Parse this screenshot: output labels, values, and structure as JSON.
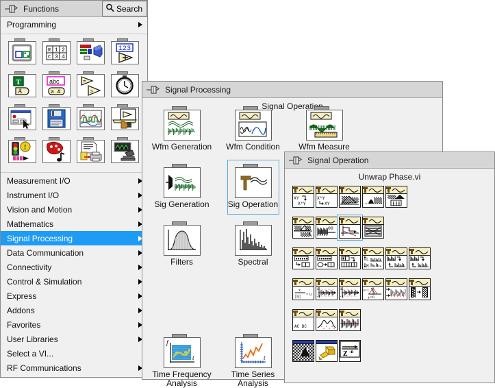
{
  "functions_palette": {
    "title": "Functions",
    "pin_icon": "pin-icon",
    "search": {
      "label": "Search",
      "icon": "search-icon"
    },
    "top_item": {
      "label": "Programming",
      "arrow": "chevron-right-icon"
    },
    "icon_rows": [
      [
        {
          "name": "structures-folder",
          "icon": "structures-icon"
        },
        {
          "name": "array-folder",
          "icon": "array-grid-icon"
        },
        {
          "name": "cluster-class-variant-folder",
          "icon": "cluster-icon"
        },
        {
          "name": "numeric-folder",
          "icon": "numeric-123-icon"
        }
      ],
      [
        {
          "name": "boolean-folder",
          "icon": "boolean-t-icon"
        },
        {
          "name": "string-folder",
          "icon": "string-abc-icon"
        },
        {
          "name": "comparison-folder",
          "icon": "comparison-icon"
        },
        {
          "name": "timing-folder",
          "icon": "clock-icon"
        }
      ],
      [
        {
          "name": "dialog-user-interface-folder",
          "icon": "dialog-cursor-icon"
        },
        {
          "name": "file-io-folder",
          "icon": "floppy-disk-icon"
        },
        {
          "name": "waveform-folder",
          "icon": "waveform-graph-icon"
        },
        {
          "name": "application-control-folder",
          "icon": "hand-vi-icon"
        }
      ],
      [
        {
          "name": "synchronization-folder",
          "icon": "traffic-light-icon"
        },
        {
          "name": "graphics-sound-folder",
          "icon": "palette-note-icon"
        },
        {
          "name": "report-generation-folder",
          "icon": "printer-doc-icon"
        },
        {
          "name": "measurement-folder",
          "icon": "microscope-icon"
        }
      ]
    ],
    "menu_items": [
      {
        "label": "Measurement I/O",
        "selected": false,
        "has_arrow": true
      },
      {
        "label": "Instrument I/O",
        "selected": false,
        "has_arrow": true
      },
      {
        "label": "Vision and Motion",
        "selected": false,
        "has_arrow": true
      },
      {
        "label": "Mathematics",
        "selected": false,
        "has_arrow": true
      },
      {
        "label": "Signal Processing",
        "selected": true,
        "has_arrow": true
      },
      {
        "label": "Data Communication",
        "selected": false,
        "has_arrow": true
      },
      {
        "label": "Connectivity",
        "selected": false,
        "has_arrow": true
      },
      {
        "label": "Control & Simulation",
        "selected": false,
        "has_arrow": true
      },
      {
        "label": "Express",
        "selected": false,
        "has_arrow": true
      },
      {
        "label": "Addons",
        "selected": false,
        "has_arrow": true
      },
      {
        "label": "Favorites",
        "selected": false,
        "has_arrow": true
      },
      {
        "label": "User Libraries",
        "selected": false,
        "has_arrow": true
      },
      {
        "label": "Select a VI...",
        "selected": false,
        "has_arrow": false
      },
      {
        "label": "RF Communications",
        "selected": false,
        "has_arrow": true
      }
    ]
  },
  "signal_processing_palette": {
    "title": "Signal Processing",
    "pin_icon": "pin-icon",
    "hover_caption": "Signal Operation",
    "items": [
      {
        "label": "Wfm Generation",
        "icon": "wfm-generation-icon",
        "selected": false
      },
      {
        "label": "Wfm Condition",
        "icon": "wfm-condition-icon",
        "selected": false
      },
      {
        "label": "Wfm Measure",
        "icon": "wfm-measure-icon",
        "selected": false
      },
      {
        "label": "Sig Generation",
        "icon": "sig-generation-icon",
        "selected": false
      },
      {
        "label": "Sig Operation",
        "icon": "sig-operation-icon",
        "selected": true
      },
      {
        "label": "Filters",
        "icon": "filters-icon",
        "selected": false
      },
      {
        "label": "Spectral",
        "icon": "spectral-icon",
        "selected": false
      },
      {
        "label": "Time Frequency\nAnalysis",
        "icon": "time-frequency-analysis-icon",
        "selected": false
      },
      {
        "label": "Time Series\nAnalysis",
        "icon": "time-series-analysis-icon",
        "selected": false
      }
    ],
    "item_labels": {
      "wfm_generation": "Wfm Generation",
      "wfm_condition": "Wfm Condition",
      "wfm_measure": "Wfm Measure",
      "sig_generation": "Sig Generation",
      "sig_operation": "Sig Operation",
      "filters": "Filters",
      "spectral": "Spectral",
      "time_frequency_1": "Time Frequency",
      "time_frequency_2": "Analysis",
      "time_series_1": "Time Series",
      "time_series_2": "Analysis"
    }
  },
  "signal_operation_palette": {
    "title": "Signal Operation",
    "pin_icon": "pin-icon",
    "hover_caption": "Unwrap Phase.vi",
    "selected_index": 8,
    "vis": [
      {
        "name": "convolution-vi",
        "row": 0,
        "col": 0,
        "icon": "xy-convolution-icon",
        "selected": false
      },
      {
        "name": "deconvolution-vi",
        "row": 0,
        "col": 1,
        "icon": "xy-deconvolution-icon",
        "selected": false
      },
      {
        "name": "cross-correlation-vi",
        "row": 0,
        "col": 2,
        "icon": "cross-correlation-icon",
        "selected": false
      },
      {
        "name": "autocorrelation-vi",
        "row": 0,
        "col": 3,
        "icon": "autocorrelation-icon",
        "selected": false
      },
      {
        "name": "conv-matrix-vi",
        "row": 0,
        "col": 4,
        "icon": "conv-matrix-icon",
        "selected": false
      },
      {
        "name": "deconv-matrix-vi",
        "row": 1,
        "col": 0,
        "icon": "deconv-matrix-icon",
        "selected": false
      },
      {
        "name": "zero-padder-vi",
        "row": 1,
        "col": 1,
        "icon": "zero-padder-icon",
        "selected": false
      },
      {
        "name": "unwrap-phase-vi",
        "row": 1,
        "col": 2,
        "icon": "unwrap-phase-icon",
        "selected": true
      },
      {
        "name": "resample-vi",
        "row": 1,
        "col": 3,
        "icon": "resample-icon",
        "selected": false
      },
      {
        "name": "decimate-vi",
        "row": 2,
        "col": 0,
        "icon": "decimate-icon",
        "selected": false
      },
      {
        "name": "decimate-continuous-vi",
        "row": 2,
        "col": 1,
        "icon": "decimate-cont-icon",
        "selected": false
      },
      {
        "name": "array-to-cluster-vi",
        "row": 2,
        "col": 2,
        "icon": "array-to-cluster-icon",
        "selected": false
      },
      {
        "name": "lm-resample-vi",
        "row": 2,
        "col": 3,
        "icon": "lm-resample-icon",
        "selected": false
      },
      {
        "name": "interpolate-vi",
        "row": 2,
        "col": 4,
        "icon": "interpolate-icon",
        "selected": false
      },
      {
        "name": "decimate-2-vi",
        "row": 2,
        "col": 5,
        "icon": "decimate-2-icon",
        "selected": false
      },
      {
        "name": "normalize-vi",
        "row": 3,
        "col": 0,
        "icon": "normalize-icon",
        "selected": false
      },
      {
        "name": "quantize-vi",
        "row": 3,
        "col": 1,
        "icon": "quantize-icon",
        "selected": false
      },
      {
        "name": "quantize-2-vi",
        "row": 3,
        "col": 2,
        "icon": "quantize-2-icon",
        "selected": false
      },
      {
        "name": "normalize-sigma-vi",
        "row": 3,
        "col": 3,
        "icon": "normalize-sigma-icon",
        "selected": false
      },
      {
        "name": "scaled-noise-vi",
        "row": 3,
        "col": 4,
        "icon": "scaled-noise-icon",
        "selected": false
      },
      {
        "name": "array-convert-vi",
        "row": 3,
        "col": 5,
        "icon": "array-convert-icon",
        "selected": false
      },
      {
        "name": "ac-dc-estimator-vi",
        "row": 4,
        "col": 0,
        "icon": "ac-dc-estimator-icon",
        "selected": false
      },
      {
        "name": "peak-detect-vi",
        "row": 4,
        "col": 1,
        "icon": "peak-detect-icon",
        "selected": false
      },
      {
        "name": "threshold-peak-vi",
        "row": 4,
        "col": 2,
        "icon": "threshold-peak-icon",
        "selected": false
      },
      {
        "name": "checker-vi",
        "row": 5,
        "col": 0,
        "icon": "checkerboard-icon",
        "selected": false
      },
      {
        "name": "highlight-vi",
        "row": 5,
        "col": 1,
        "icon": "highlighter-icon",
        "selected": false
      },
      {
        "name": "z-transform-vi",
        "row": 5,
        "col": 2,
        "icon": "z-transform-icon",
        "selected": false
      }
    ],
    "labels": {
      "xy_conv_top": "XY",
      "xy_conv_bot": "X*Y",
      "xy_deconv_top": "X*Y",
      "xy_deconv_bot": "XY",
      "zero_pad": "00",
      "lm_l": "L",
      "lm_m": "M",
      "normalize_num": "x",
      "normalize_den": "||x||",
      "normalize_res": "u",
      "sigma": "σ=1",
      "mu": "μ=0",
      "acdc": "AC DC",
      "one_pos": "1",
      "one_neg": "-1",
      "z_label": "Z",
      "z_exp": "-n"
    }
  },
  "colors": {
    "window_bg": "#f0f0f0",
    "titlebar": "#d6d6d6",
    "selection_blue": "#1e9cf5",
    "selection_border": "#5aa9de",
    "vi_header_yellow": "#f5eec3",
    "vi_header_blue": "#2a3ea8",
    "border": "#8a8a8a",
    "text": "#111111"
  }
}
